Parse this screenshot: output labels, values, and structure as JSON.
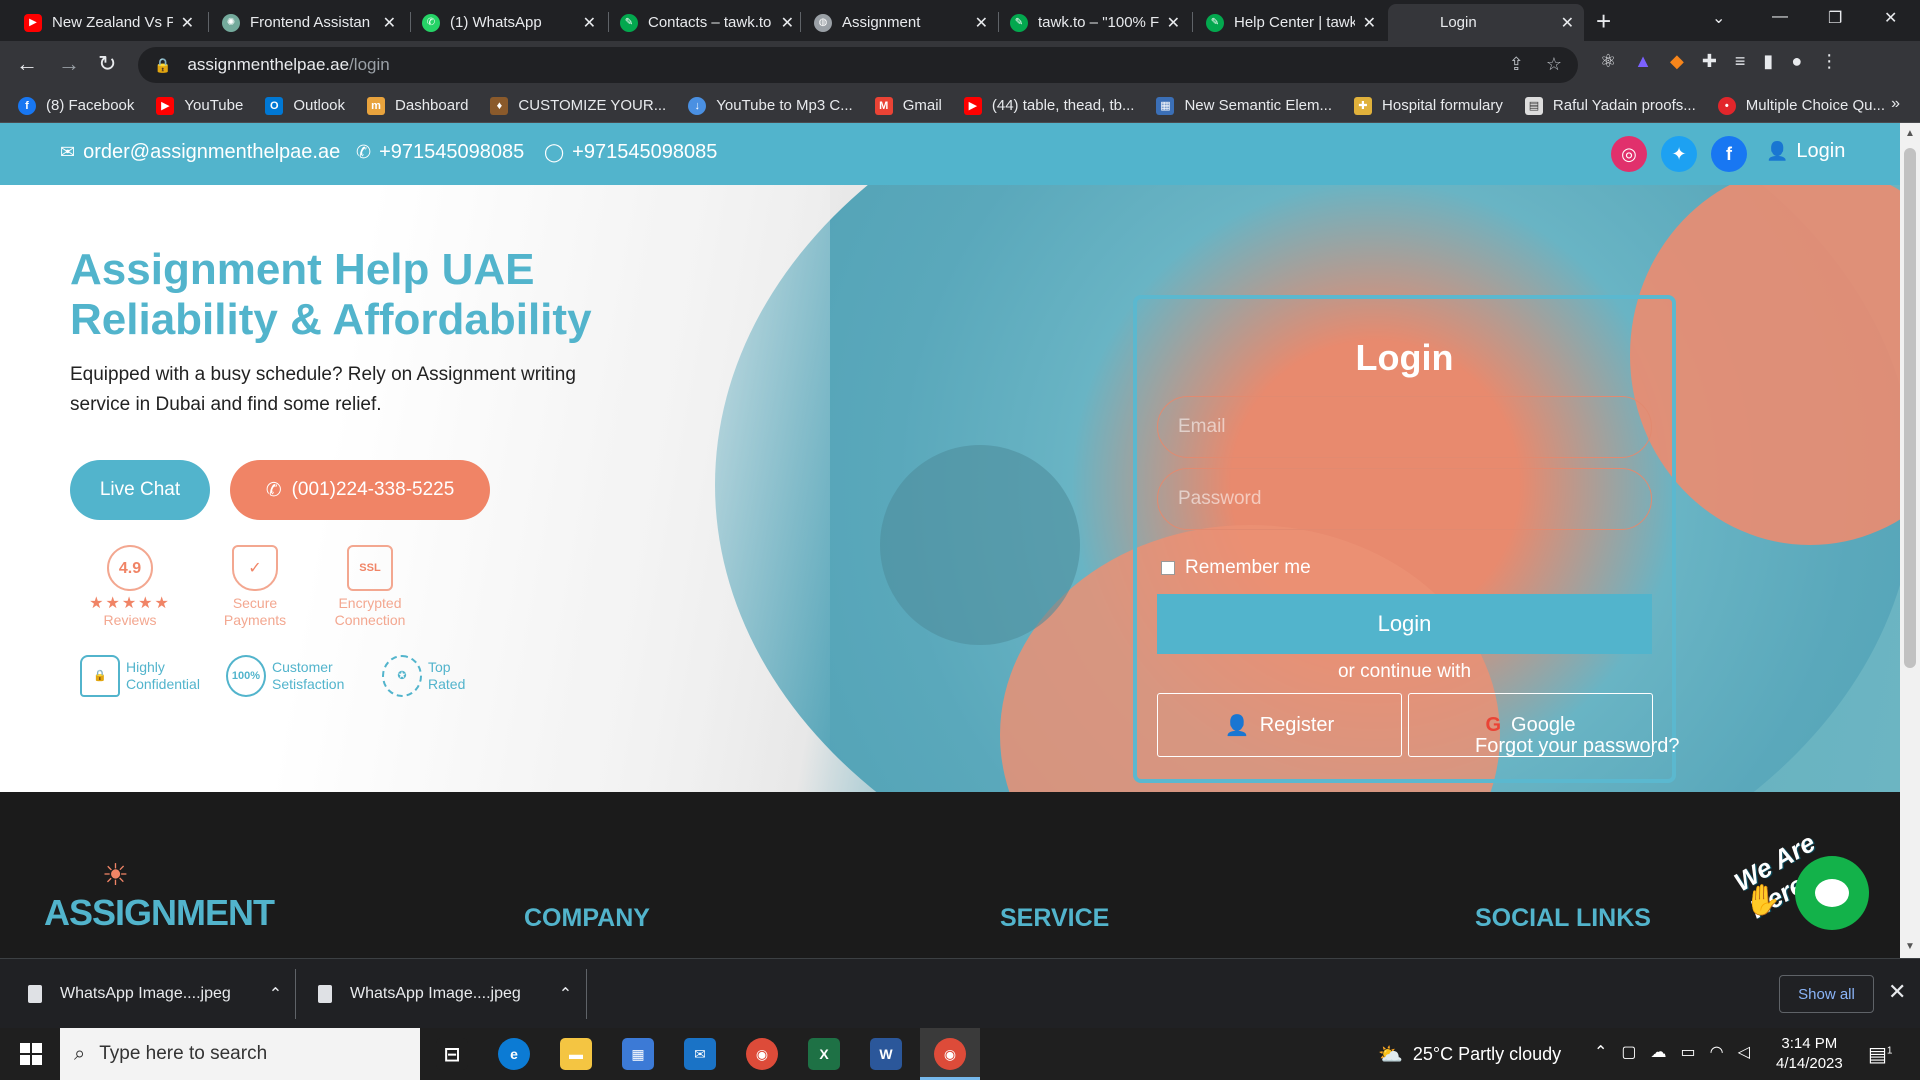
{
  "browser": {
    "tabs": [
      {
        "title": "New Zealand Vs P",
        "icon": "youtube-icon",
        "color": "#ff0000"
      },
      {
        "title": "Frontend Assistan",
        "icon": "openai-icon",
        "color": "#74aa9c"
      },
      {
        "title": "(1) WhatsApp",
        "icon": "whatsapp-icon",
        "color": "#25d366"
      },
      {
        "title": "Contacts – tawk.to",
        "icon": "tawk-icon",
        "color": "#03a84e"
      },
      {
        "title": "Assignment",
        "icon": "globe-icon",
        "color": "#9aa0a6"
      },
      {
        "title": "tawk.to – \"100% F",
        "icon": "tawk-icon",
        "color": "#03a84e"
      },
      {
        "title": "Help Center | tawk",
        "icon": "tawk-icon",
        "color": "#03a84e"
      },
      {
        "title": "Login",
        "icon": "none",
        "color": "#35363a"
      }
    ],
    "address": {
      "domain": "assignmenthelpae.ae",
      "path": "/login"
    },
    "bookmarks": [
      {
        "label": "(8) Facebook",
        "icon": "facebook-icon",
        "color": "#1877f2"
      },
      {
        "label": "YouTube",
        "icon": "youtube-icon",
        "color": "#ff0000"
      },
      {
        "label": "Outlook",
        "icon": "outlook-icon",
        "color": "#0078d4"
      },
      {
        "label": "Dashboard",
        "icon": "dashboard-icon",
        "color": "#e8a33d"
      },
      {
        "label": "CUSTOMIZE YOUR...",
        "icon": "customize-icon",
        "color": "#8a5a2b"
      },
      {
        "label": "YouTube to Mp3 C...",
        "icon": "download-icon",
        "color": "#4a90e2"
      },
      {
        "label": "Gmail",
        "icon": "gmail-icon",
        "color": "#ea4335"
      },
      {
        "label": "(44) table, thead, tb...",
        "icon": "youtube-icon",
        "color": "#ff0000"
      },
      {
        "label": "New Semantic Elem...",
        "icon": "semantic-icon",
        "color": "#3b6fb6"
      },
      {
        "label": "Hospital formulary",
        "icon": "hospital-icon",
        "color": "#e0b13b"
      },
      {
        "label": "Raful Yadain proofs...",
        "icon": "doc-icon",
        "color": "#dddddd"
      },
      {
        "label": "Multiple Choice Qu...",
        "icon": "mcq-icon",
        "color": "#e2262b"
      }
    ],
    "bookmarks_more": "»"
  },
  "topbar": {
    "email": "order@assignmenthelpae.ae",
    "phone": "+971545098085",
    "whatsapp": "+971545098085",
    "login": "Login",
    "social_colors": {
      "instagram": "#e1306c",
      "twitter": "#1da1f2",
      "facebook": "#1877f2"
    }
  },
  "hero": {
    "title_line1": "Assignment Help UAE",
    "title_line2": "Reliability & Affordability",
    "subtitle": "Equipped with a busy schedule? Rely on Assignment writing service in Dubai and find some relief.",
    "live_chat": "Live Chat",
    "phone_button": "(001)224-338-5225",
    "badges": {
      "rating": "4.9",
      "stars": "★★★★★",
      "reviews": "Reviews",
      "secure_line1": "Secure",
      "secure_line2": "Payments",
      "ssl": "SSL",
      "encrypted_line1": "Encrypted",
      "encrypted_line2": "Connection",
      "confidential_line1": "Highly",
      "confidential_line2": "Confidential",
      "satisfaction_badge": "100%",
      "satisfaction_line1": "Customer",
      "satisfaction_line2": "Setisfaction",
      "top_line1": "Top",
      "top_line2": "Rated"
    }
  },
  "login_form": {
    "title": "Login",
    "email_placeholder": "Email",
    "password_placeholder": "Password",
    "remember": "Remember me",
    "submit": "Login",
    "or_text": "or continue with",
    "register": "Register",
    "google": "Google",
    "forgot": "Forgot your password?"
  },
  "footer": {
    "logo_text": "ASSIGNMENT",
    "company": "COMPANY",
    "service": "SERVICE",
    "social": "SOCIAL LINKS"
  },
  "chat_widget": {
    "text": "We Are Here!"
  },
  "downloads": {
    "items": [
      "WhatsApp Image....jpeg",
      "WhatsApp Image....jpeg"
    ],
    "show_all": "Show all"
  },
  "taskbar": {
    "search_placeholder": "Type here to search",
    "weather": "25°C  Partly cloudy",
    "time": "3:14 PM",
    "date": "4/14/2023",
    "notification_count": "1"
  }
}
